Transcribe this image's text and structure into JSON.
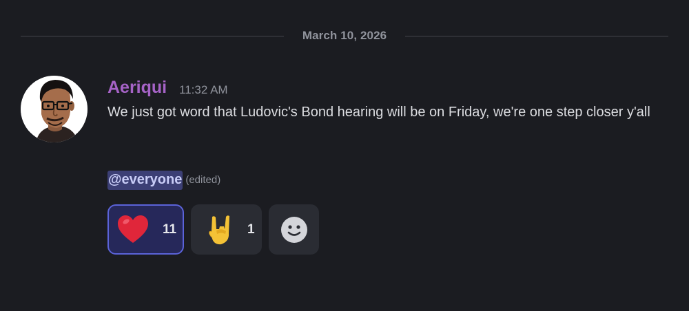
{
  "divider": {
    "date": "March 10, 2026"
  },
  "message": {
    "author": "Aeriqui",
    "timestamp": "11:32 AM",
    "content": "We just got word that Ludovic's Bond hearing will be on Friday, we're one step closer y'all",
    "mention": "@everyone",
    "edited_label": "(edited)",
    "author_color": "#a663c7"
  },
  "reactions": [
    {
      "icon": "heart-icon",
      "count": "11",
      "active": true
    },
    {
      "icon": "rock-on-hand-icon",
      "count": "1",
      "active": false
    },
    {
      "icon": "add-reaction-smiley-icon",
      "count": null
    }
  ],
  "colors": {
    "background": "#1b1c21",
    "mention_bg": "#3c3f75",
    "active_border": "#5b63d9"
  }
}
